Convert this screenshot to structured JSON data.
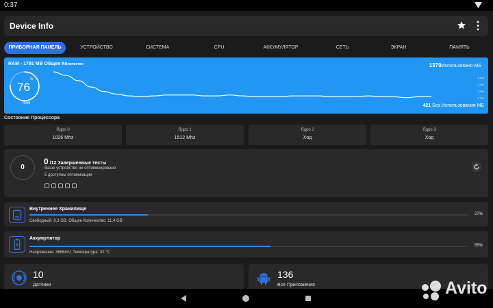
{
  "status_bar": {
    "time": "0:37"
  },
  "app_bar": {
    "title": "Device Info"
  },
  "tabs": [
    {
      "label": "ПРИБОРНАЯ ПАНЕЛЬ",
      "active": true
    },
    {
      "label": "УСТРОЙСТВО"
    },
    {
      "label": "СИСТЕМА"
    },
    {
      "label": "CPU"
    },
    {
      "label": "АККУМУЛЯТОР"
    },
    {
      "label": "СЕТЬ"
    },
    {
      "label": "ЭКРАН"
    },
    {
      "label": "ПАМЯТЬ"
    }
  ],
  "ram": {
    "title_main": "RAM - 1791 MB Общее Ко",
    "title_small": "личество",
    "percent": "76",
    "percent_sign": "%",
    "gauge_label": "RAM",
    "used_value": "1370",
    "used_label": "Использовано МБ",
    "free_value": "421",
    "free_label": " Без Использования МБ",
    "y_ticks": [
      "1 400",
      "1 390",
      "1 380",
      "1 370"
    ],
    "history_mb": [
      1400,
      1396,
      1390,
      1383,
      1378,
      1375,
      1373,
      1372,
      1373,
      1374,
      1374,
      1374,
      1373,
      1373,
      1374,
      1373,
      1372,
      1372,
      1372,
      1373,
      1373,
      1373,
      1372,
      1372,
      1372,
      1373,
      1372,
      1372,
      1371,
      1372,
      1372
    ]
  },
  "cpu_section_title": "Состояние Процессора",
  "cores": [
    {
      "name": "Ядро 0",
      "value": "1026 Mhz"
    },
    {
      "name": "Ядро 1",
      "value": "1512 Mhz"
    },
    {
      "name": "Ядро 2",
      "value": "Ход"
    },
    {
      "name": "Ядро 3",
      "value": "Ход"
    }
  ],
  "benchmark": {
    "circle": "0",
    "count": "0",
    "count_rest": " /12 Завершенные тесты",
    "line1": "Ваше устройство не оптимизировано",
    "line2": "5 доступны оптимизации"
  },
  "storage": {
    "title": "Внутреннее Хранилище",
    "percent": "27%",
    "fill": 0.27,
    "details": "Свободный: 8,3 GB,  Общее Количество: 11,4 GB"
  },
  "battery": {
    "title": "Аккумулятор",
    "percent": "55%",
    "fill": 0.55,
    "details": "Напряжение: 3686mV,  Температура: 32 ℃"
  },
  "sensors": {
    "count": "10",
    "label": "Датчики"
  },
  "apps": {
    "count": "136",
    "label": "Все Приложения"
  },
  "watermark": {
    "text": "Avito"
  },
  "colors": {
    "accent": "#2196f3",
    "tab_active": "#2f6fe0",
    "card": "#292929",
    "background": "#1b1b1b"
  }
}
